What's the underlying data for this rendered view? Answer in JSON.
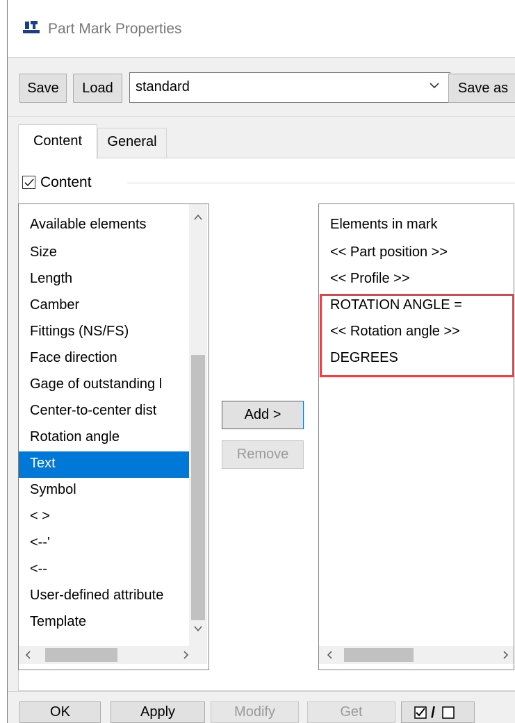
{
  "window": {
    "title": "Part Mark Properties"
  },
  "toolbar": {
    "save_label": "Save",
    "load_label": "Load",
    "settings_value": "standard",
    "save_as_label": "Save as"
  },
  "tabs": [
    {
      "label": "Content",
      "active": true
    },
    {
      "label": "General",
      "active": false
    }
  ],
  "content_group": {
    "checkbox_label": "Content",
    "checked": true
  },
  "available": {
    "header": "Available elements",
    "items": [
      "Size",
      "Length",
      "Camber",
      "Fittings (NS/FS)",
      "Face direction",
      "Gage of outstanding l",
      "Center-to-center dist",
      "Rotation angle",
      "Text",
      "Symbol",
      "< >",
      "<--'",
      "<--",
      "User-defined attribute",
      "Template"
    ],
    "selected": "Text"
  },
  "buttons": {
    "add_label": "Add >",
    "remove_label": "Remove"
  },
  "mark": {
    "header": "Elements in mark",
    "items": [
      "<< Part position >>",
      "<< Profile >>",
      "ROTATION ANGLE =",
      "<< Rotation angle >>",
      "DEGREES"
    ],
    "highlighted": [
      "ROTATION ANGLE =",
      "<< Rotation angle >>",
      "DEGREES"
    ],
    "highlight_color": "#e8414a"
  },
  "footer": {
    "ok_label": "OK",
    "apply_label": "Apply",
    "modify_label": "Modify",
    "get_label": "Get",
    "toggle_label": "/"
  },
  "colors": {
    "selection": "#0078d7",
    "window_bg": "#f0f0f0",
    "disabled_text": "#9a9a9a"
  }
}
